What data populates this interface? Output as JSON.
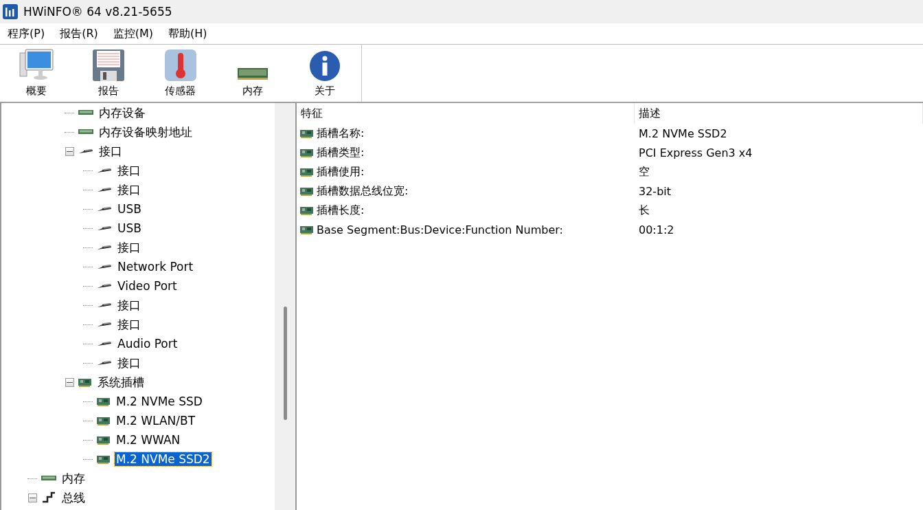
{
  "window": {
    "title": "HWiNFO® 64 v8.21-5655"
  },
  "menu": [
    "程序(P)",
    "报告(R)",
    "监控(M)",
    "帮助(H)"
  ],
  "toolbar": [
    {
      "kind": "monitor",
      "label": "概要"
    },
    {
      "kind": "floppy",
      "label": "报告"
    },
    {
      "kind": "thermometer",
      "label": "传感器"
    },
    {
      "kind": "memory",
      "label": "内存"
    },
    {
      "kind": "info",
      "label": "关于"
    }
  ],
  "tree": {
    "items": [
      {
        "kind": "continued",
        "children": [
          {
            "kind": "continued",
            "children": [
              {
                "kind": "memory",
                "label": "内存设备",
                "selected": false
              },
              {
                "kind": "memory",
                "label": "内存设备映射地址",
                "selected": false
              },
              {
                "kind": "port",
                "label": "接口",
                "selected": false,
                "expanded": true,
                "children": [
                  {
                    "kind": "port",
                    "label": "接口",
                    "selected": false
                  },
                  {
                    "kind": "port",
                    "label": "接口",
                    "selected": false
                  },
                  {
                    "kind": "port",
                    "label": "USB",
                    "selected": false
                  },
                  {
                    "kind": "port",
                    "label": "USB",
                    "selected": false
                  },
                  {
                    "kind": "port",
                    "label": "接口",
                    "selected": false
                  },
                  {
                    "kind": "port",
                    "label": "Network Port",
                    "selected": false
                  },
                  {
                    "kind": "port",
                    "label": "Video Port",
                    "selected": false
                  },
                  {
                    "kind": "port",
                    "label": "接口",
                    "selected": false
                  },
                  {
                    "kind": "port",
                    "label": "接口",
                    "selected": false
                  },
                  {
                    "kind": "port",
                    "label": "Audio Port",
                    "selected": false
                  },
                  {
                    "kind": "port",
                    "label": "接口",
                    "selected": false
                  }
                ]
              },
              {
                "kind": "card",
                "label": "系统插槽",
                "selected": false,
                "expanded": true,
                "children": [
                  {
                    "kind": "card",
                    "label": "M.2 NVMe SSD",
                    "selected": false
                  },
                  {
                    "kind": "card",
                    "label": "M.2 WLAN/BT",
                    "selected": false
                  },
                  {
                    "kind": "card",
                    "label": "M.2 WWAN",
                    "selected": false
                  },
                  {
                    "kind": "card",
                    "label": "M.2 NVMe SSD2",
                    "selected": true
                  }
                ]
              }
            ]
          }
        ]
      },
      {
        "kind": "memory",
        "label": "内存",
        "selected": false
      },
      {
        "kind": "bus",
        "label": "总线",
        "selected": false,
        "expanded": true
      }
    ]
  },
  "details": {
    "columns": [
      "特征",
      "描述"
    ],
    "rows": [
      {
        "feature": "插槽名称:",
        "value": "M.2 NVMe SSD2"
      },
      {
        "feature": "插槽类型:",
        "value": "PCI Express Gen3 x4"
      },
      {
        "feature": "插槽使用:",
        "value": "空"
      },
      {
        "feature": "插槽数据总线位宽:",
        "value": "32-bit"
      },
      {
        "feature": "插槽长度:",
        "value": "长"
      },
      {
        "feature": "Base Segment:Bus:Device:Function Number:",
        "value": "00:1:2"
      }
    ]
  }
}
